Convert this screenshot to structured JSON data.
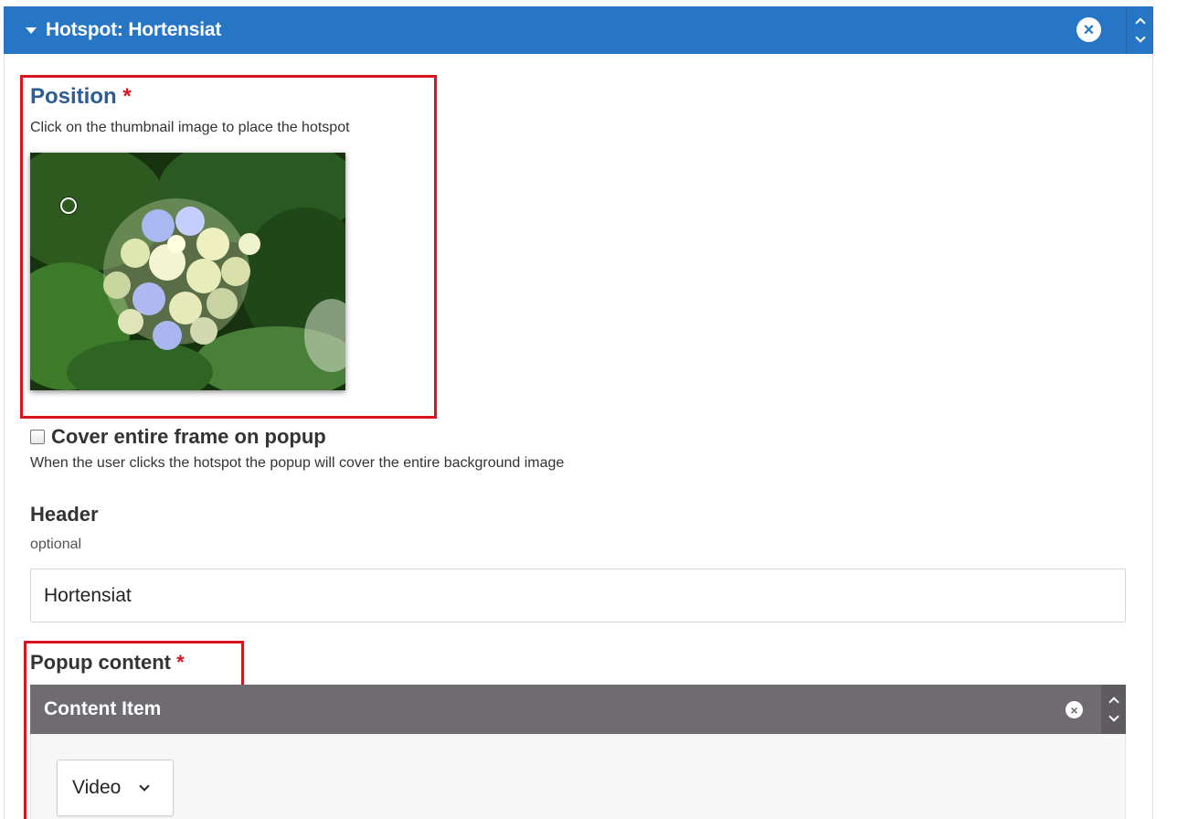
{
  "hotspot": {
    "title": "Hotspot: Hortensiat",
    "remove_icon": "close-circle-icon",
    "reorder_icons": [
      "chevron-up-icon",
      "chevron-down-icon"
    ],
    "accent_color": "#2775c5"
  },
  "position": {
    "label": "Position",
    "required_mark": "*",
    "help": "Click on the thumbnail image to place the hotspot",
    "thumbnail_image": "hydrangea-flower-photo",
    "marker_icon": "hotspot-circle-icon"
  },
  "cover": {
    "label": "Cover entire frame on popup",
    "checked": false,
    "help": "When the user clicks the hotspot the popup will cover the entire background image"
  },
  "header": {
    "label": "Header",
    "help": "optional",
    "value": "Hortensiat"
  },
  "popup": {
    "label": "Popup content",
    "required_mark": "*",
    "content_item": {
      "title": "Content Item",
      "remove_icon": "close-circle-icon",
      "color": "#6e6c70"
    },
    "type_select": {
      "value": "Video"
    }
  },
  "highlight_color": "#d9141e"
}
